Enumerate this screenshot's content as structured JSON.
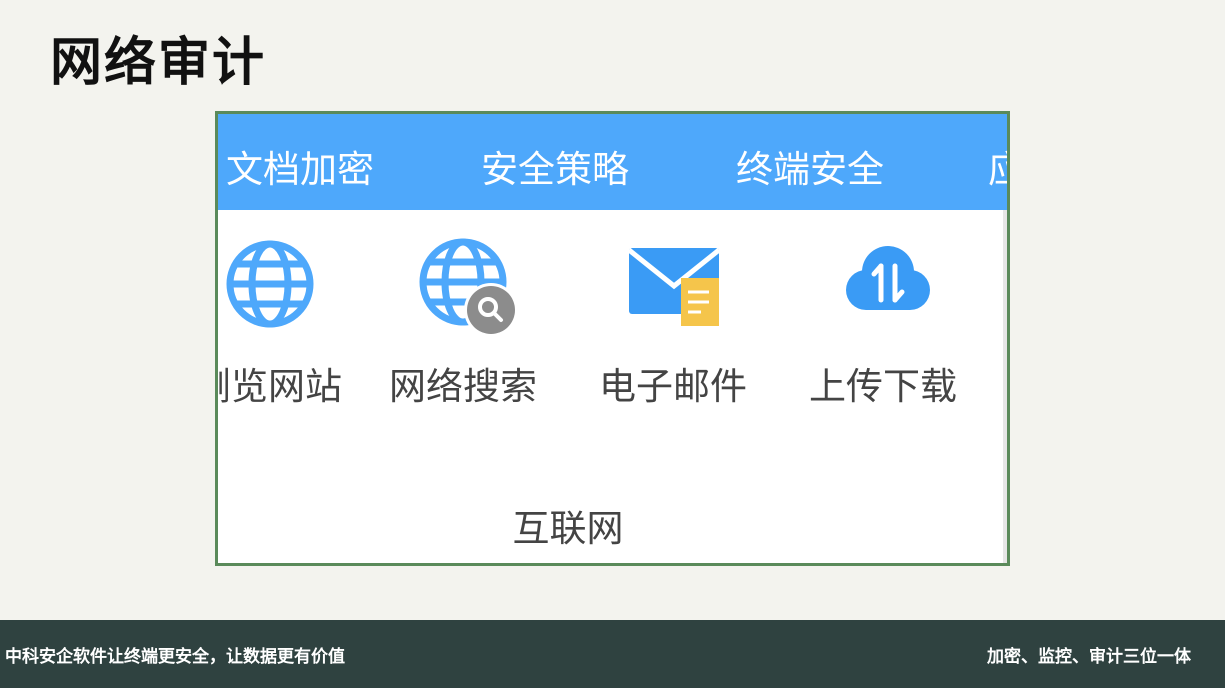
{
  "slide": {
    "title": "网络审计"
  },
  "screenshot": {
    "tabs": [
      {
        "label": "文档加密"
      },
      {
        "label": "安全策略"
      },
      {
        "label": "终端安全"
      },
      {
        "label": "应"
      }
    ],
    "tools": [
      {
        "label": "浏览网站",
        "icon": "globe-icon"
      },
      {
        "label": "网络搜索",
        "icon": "globe-search-icon"
      },
      {
        "label": "电子邮件",
        "icon": "email-icon"
      },
      {
        "label": "上传下载",
        "icon": "cloud-transfer-icon"
      }
    ],
    "group_label": "互联网"
  },
  "footer": {
    "left": "中科安企软件让终端更安全，让数据更有价值",
    "right": "加密、监控、审计三位一体"
  },
  "colors": {
    "tab_bar": "#4ea8fb",
    "frame_border": "#5a8a5a",
    "footer": "#2f4240",
    "icon_blue": "#4ea8fb",
    "badge_gray": "#8c8c8c",
    "doc_yellow": "#f5c54b"
  }
}
